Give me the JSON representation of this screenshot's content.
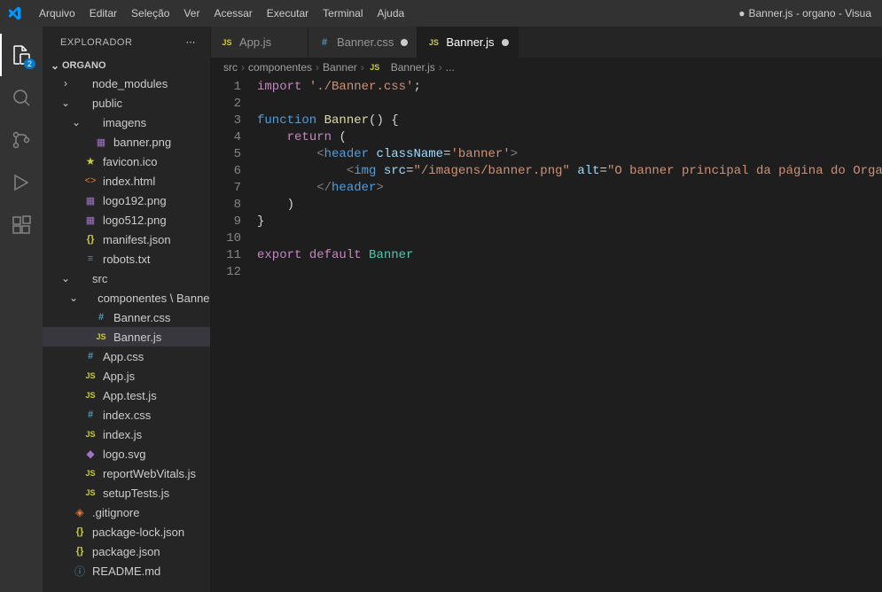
{
  "menubar": {
    "items": [
      "Arquivo",
      "Editar",
      "Seleção",
      "Ver",
      "Acessar",
      "Executar",
      "Terminal",
      "Ajuda"
    ]
  },
  "window": {
    "title": "Banner.js - organo - Visua",
    "dirty_indicator": "●"
  },
  "activitybar": {
    "explorer_badge": "2"
  },
  "sidebar": {
    "title": "EXPLORADOR",
    "project": "ORGANO",
    "tree": [
      {
        "indent": 1,
        "type": "folder",
        "chev": "›",
        "label": "node_modules",
        "icon": "folder"
      },
      {
        "indent": 1,
        "type": "folder",
        "chev": "⌄",
        "label": "public",
        "icon": "folder"
      },
      {
        "indent": 2,
        "type": "folder",
        "chev": "⌄",
        "label": "imagens",
        "icon": "folder"
      },
      {
        "indent": 3,
        "type": "file",
        "label": "banner.png",
        "icon": "img"
      },
      {
        "indent": 2,
        "type": "file",
        "label": "favicon.ico",
        "icon": "fav"
      },
      {
        "indent": 2,
        "type": "file",
        "label": "index.html",
        "icon": "html"
      },
      {
        "indent": 2,
        "type": "file",
        "label": "logo192.png",
        "icon": "img"
      },
      {
        "indent": 2,
        "type": "file",
        "label": "logo512.png",
        "icon": "img"
      },
      {
        "indent": 2,
        "type": "file",
        "label": "manifest.json",
        "icon": "json"
      },
      {
        "indent": 2,
        "type": "file",
        "label": "robots.txt",
        "icon": "txt"
      },
      {
        "indent": 1,
        "type": "folder",
        "chev": "⌄",
        "label": "src",
        "icon": "folder"
      },
      {
        "indent": 2,
        "type": "folder",
        "chev": "⌄",
        "label": "componentes \\ Banner",
        "icon": "folder"
      },
      {
        "indent": 3,
        "type": "file",
        "label": "Banner.css",
        "icon": "css"
      },
      {
        "indent": 3,
        "type": "file",
        "label": "Banner.js",
        "icon": "js",
        "selected": true
      },
      {
        "indent": 2,
        "type": "file",
        "label": "App.css",
        "icon": "css"
      },
      {
        "indent": 2,
        "type": "file",
        "label": "App.js",
        "icon": "js"
      },
      {
        "indent": 2,
        "type": "file",
        "label": "App.test.js",
        "icon": "js"
      },
      {
        "indent": 2,
        "type": "file",
        "label": "index.css",
        "icon": "css"
      },
      {
        "indent": 2,
        "type": "file",
        "label": "index.js",
        "icon": "js"
      },
      {
        "indent": 2,
        "type": "file",
        "label": "logo.svg",
        "icon": "svg"
      },
      {
        "indent": 2,
        "type": "file",
        "label": "reportWebVitals.js",
        "icon": "js"
      },
      {
        "indent": 2,
        "type": "file",
        "label": "setupTests.js",
        "icon": "js"
      },
      {
        "indent": 1,
        "type": "file",
        "label": ".gitignore",
        "icon": "git"
      },
      {
        "indent": 1,
        "type": "file",
        "label": "package-lock.json",
        "icon": "json"
      },
      {
        "indent": 1,
        "type": "file",
        "label": "package.json",
        "icon": "json"
      },
      {
        "indent": 1,
        "type": "file",
        "label": "README.md",
        "icon": "info"
      }
    ]
  },
  "tabs": [
    {
      "label": "App.js",
      "icon": "js",
      "dirty": false,
      "active": false
    },
    {
      "label": "Banner.css",
      "icon": "css",
      "dirty": true,
      "active": false
    },
    {
      "label": "Banner.js",
      "icon": "js",
      "dirty": true,
      "active": true
    }
  ],
  "breadcrumbs": [
    "src",
    "componentes",
    "Banner",
    "Banner.js",
    "..."
  ],
  "breadcrumb_icons": {
    "3": "js"
  },
  "code": {
    "lines": [
      {
        "n": 1,
        "html": "<span class='tk-kw'>import</span> <span class='tk-str'>'./Banner.css'</span><span class='tk-punc'>;</span>"
      },
      {
        "n": 2,
        "html": ""
      },
      {
        "n": 3,
        "html": "<span class='tk-tag'>function</span> <span class='tk-fn'>Banner</span><span class='tk-punc'>() {</span>"
      },
      {
        "n": 4,
        "html": "    <span class='tk-kw'>return</span> <span class='tk-punc'>(</span>"
      },
      {
        "n": 5,
        "html": "        <span class='tk-br'>&lt;</span><span class='tk-tag'>header</span> <span class='tk-attr'>className</span><span class='tk-punc'>=</span><span class='tk-str'>'banner'</span><span class='tk-br'>&gt;</span>"
      },
      {
        "n": 6,
        "html": "            <span class='tk-br'>&lt;</span><span class='tk-tag'>img</span> <span class='tk-attr'>src</span><span class='tk-punc'>=</span><span class='tk-str'>\"/imagens/banner.png\"</span> <span class='tk-attr'>alt</span><span class='tk-punc'>=</span><span class='tk-str'>\"O banner principal da página do Organo\"</span><span class='tk-br'>/&gt;</span>"
      },
      {
        "n": 7,
        "html": "        <span class='tk-br'>&lt;/</span><span class='tk-tag'>header</span><span class='tk-br'>&gt;</span>"
      },
      {
        "n": 8,
        "html": "    <span class='tk-punc'>)</span>"
      },
      {
        "n": 9,
        "html": "<span class='tk-punc'>}</span>"
      },
      {
        "n": 10,
        "html": ""
      },
      {
        "n": 11,
        "html": "<span class='tk-kw'>export</span> <span class='tk-kw'>default</span> <span class='tk-type'>Banner</span>"
      },
      {
        "n": 12,
        "html": ""
      }
    ]
  },
  "icon_glyphs": {
    "folder": "",
    "js": "JS",
    "css": "#",
    "json": "{}",
    "html": "<>",
    "img": "▦",
    "fav": "★",
    "svg": "◆",
    "git": "◈",
    "info": "ⓘ",
    "txt": "≡"
  }
}
